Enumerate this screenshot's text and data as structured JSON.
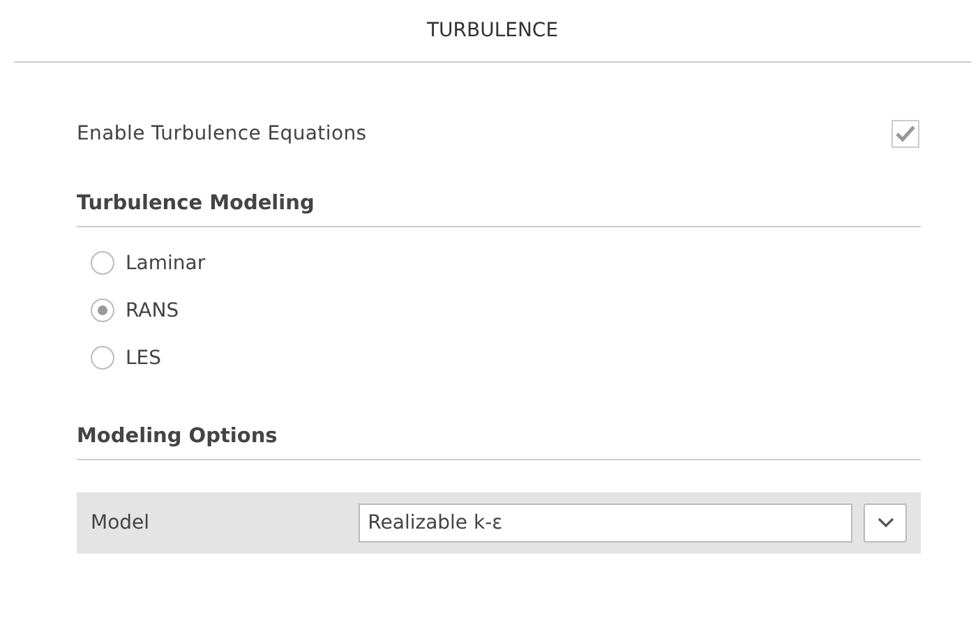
{
  "panel": {
    "title": "TURBULENCE"
  },
  "enable": {
    "label": "Enable Turbulence Equations",
    "checked": true
  },
  "sections": [
    {
      "heading": "Turbulence Modeling",
      "kind": "radios",
      "options": [
        {
          "label": "Laminar",
          "selected": false
        },
        {
          "label": "RANS",
          "selected": true
        },
        {
          "label": "LES",
          "selected": false
        }
      ]
    },
    {
      "heading": "Modeling Options",
      "kind": "fields",
      "fields": [
        {
          "label": "Model",
          "value": "Realizable k-ε"
        }
      ]
    }
  ]
}
